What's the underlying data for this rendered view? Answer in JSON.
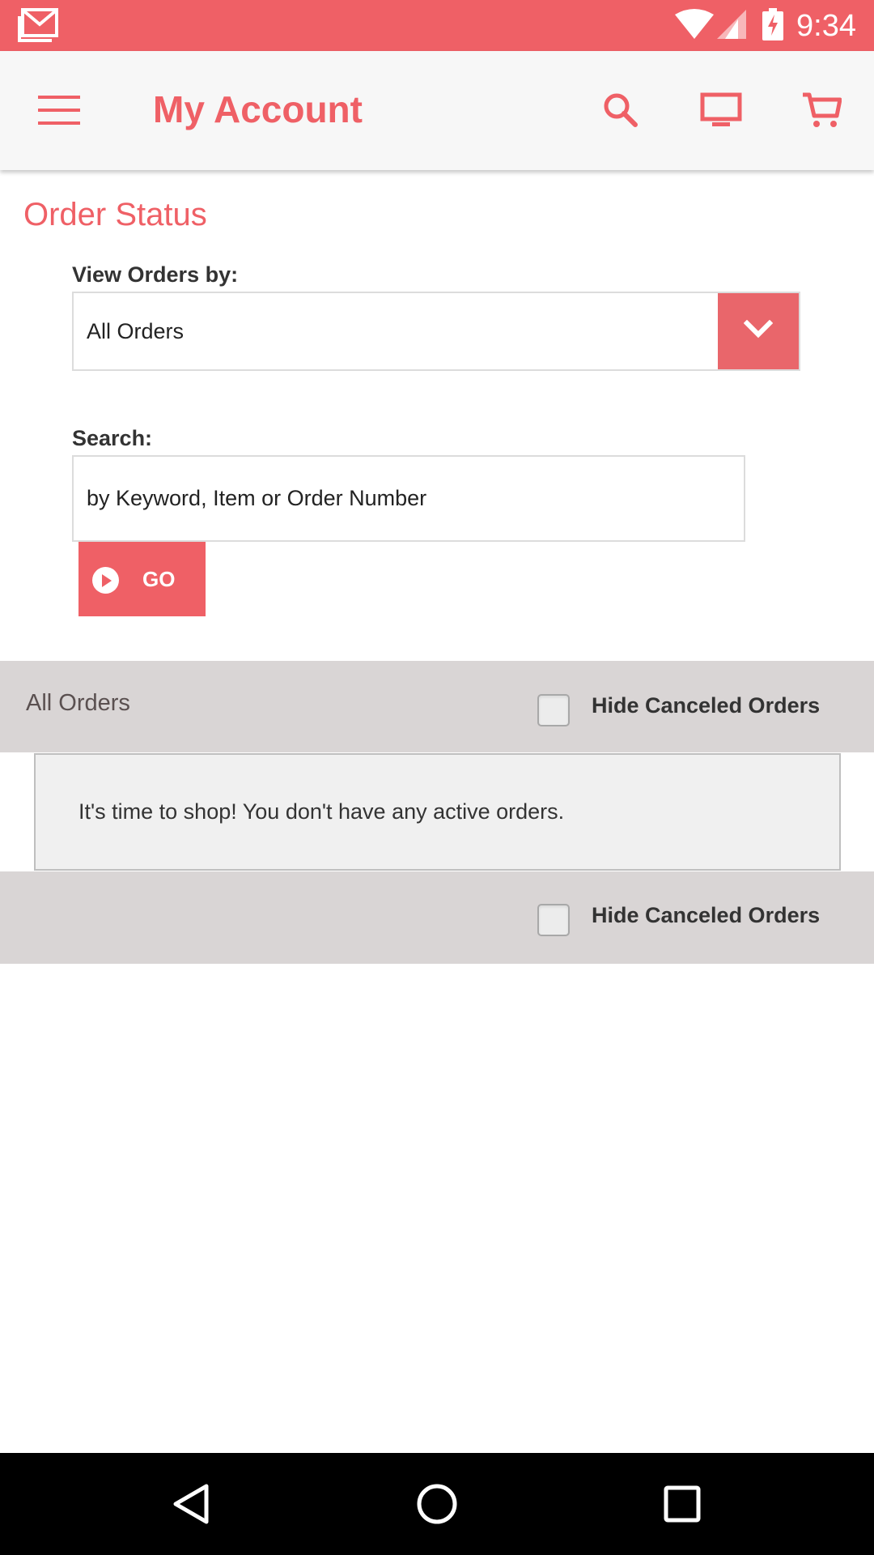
{
  "status_bar": {
    "time": "9:34",
    "icons": [
      "gmail-icon",
      "wifi-icon",
      "signal-icon",
      "battery-charging-icon"
    ]
  },
  "app_bar": {
    "title": "My Account",
    "icons": [
      "menu-icon",
      "search-icon",
      "monitor-icon",
      "cart-icon"
    ]
  },
  "order_status": {
    "title": "Order Status",
    "view_by_label": "View Orders by:",
    "view_by_value": "All Orders",
    "search_label": "Search:",
    "search_placeholder": "by Keyword, Item or Order Number",
    "go_label": "GO"
  },
  "orders_header": {
    "title": "All Orders",
    "hide_canceled_label": "Hide Canceled Orders",
    "hide_canceled_checked": false
  },
  "empty_message": "It's time to shop! You don't have any active orders.",
  "orders_footer": {
    "hide_canceled_label": "Hide Canceled Orders",
    "hide_canceled_checked": false
  },
  "nav_bar": {
    "icons": [
      "back-icon",
      "home-icon",
      "recents-icon"
    ]
  },
  "colors": {
    "accent": "#ef6066",
    "band": "#d9d5d5",
    "empty_box": "#f0f0f0"
  }
}
